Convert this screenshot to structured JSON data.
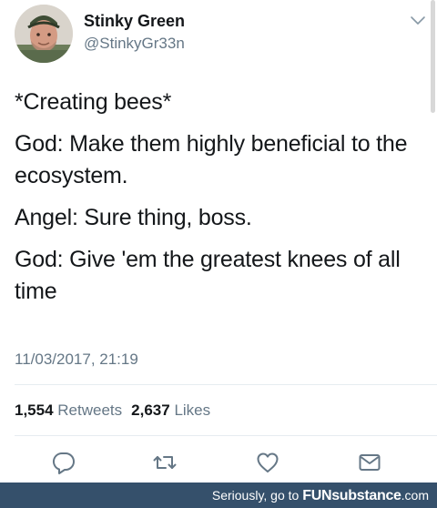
{
  "user": {
    "display_name": "Stinky Green",
    "handle": "@StinkyGr33n"
  },
  "tweet": {
    "lines": [
      "*Creating bees*",
      "God: Make them highly beneficial to the ecosystem.",
      "Angel: Sure thing, boss.",
      "God: Give 'em the greatest knees of all time"
    ],
    "timestamp": "11/03/2017, 21:19"
  },
  "stats": {
    "retweets_count": "1,554",
    "retweets_label": "Retweets",
    "likes_count": "2,637",
    "likes_label": "Likes"
  },
  "actions": {
    "icons": [
      "reply-icon",
      "retweet-icon",
      "like-icon",
      "direct-message-icon"
    ],
    "icon_color": "#657786"
  },
  "watermark": {
    "prefix": "Seriously, go to ",
    "brand": "FUNsubstance",
    "suffix": ".com"
  },
  "colors": {
    "text": "#14171a",
    "secondary": "#657786",
    "divider": "#e6ecf0",
    "footer_bg": "#35506b"
  }
}
